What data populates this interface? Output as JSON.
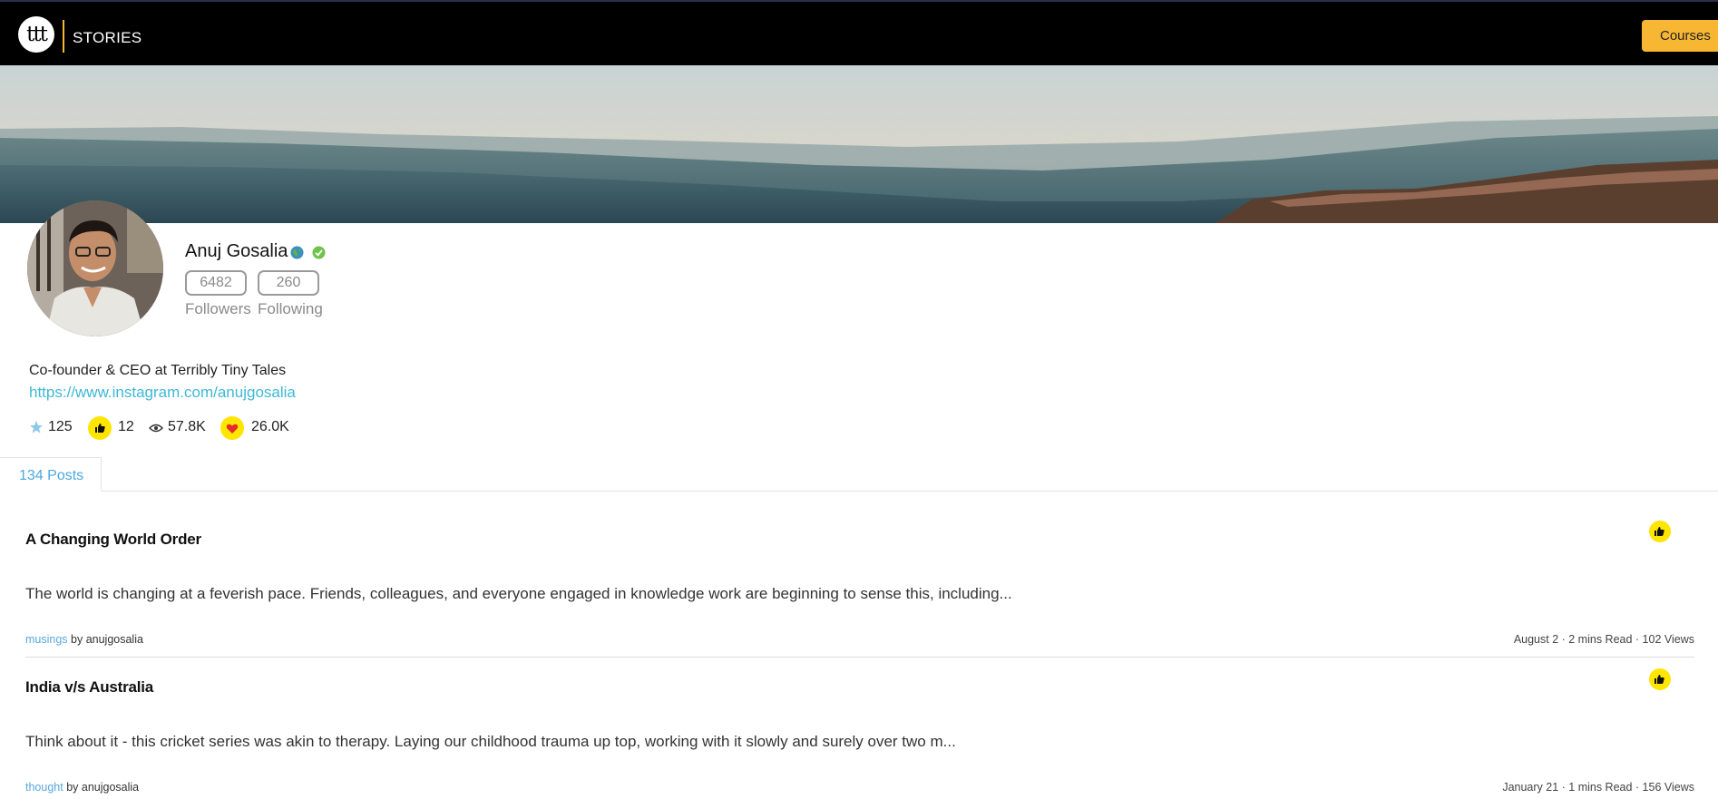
{
  "header": {
    "logo_text": "ttt",
    "brand": "STORIES",
    "courses_button": "Courses",
    "accent_color": "#f8b733"
  },
  "profile": {
    "name": "Anuj Gosalia",
    "followers_count": "6482",
    "following_count": "260",
    "followers_label": "Followers",
    "following_label": "Following",
    "bio": "Co-founder & CEO at Terribly Tiny Tales",
    "link": "https://www.instagram.com/anujgosalia",
    "stats": {
      "stars": "125",
      "likes": "12",
      "views": "57.8K",
      "hearts": "26.0K"
    }
  },
  "tabs": {
    "posts_tab": "134 Posts"
  },
  "posts": [
    {
      "title": "A Changing World Order",
      "excerpt": "The world is changing at a feverish pace. Friends, colleagues, and everyone engaged in knowledge work are beginning to sense this, including...",
      "category": "musings",
      "by": " by anujgosalia",
      "info": "August 2 · 2 mins Read · 102 Views"
    },
    {
      "title": "India v/s Australia",
      "excerpt": "Think about it - this cricket series was akin to therapy. Laying our childhood trauma up top, working with it slowly and surely over two m...",
      "category": "thought",
      "by": " by anujgosalia",
      "info": "January 21 · 1 mins Read · 156 Views"
    }
  ]
}
